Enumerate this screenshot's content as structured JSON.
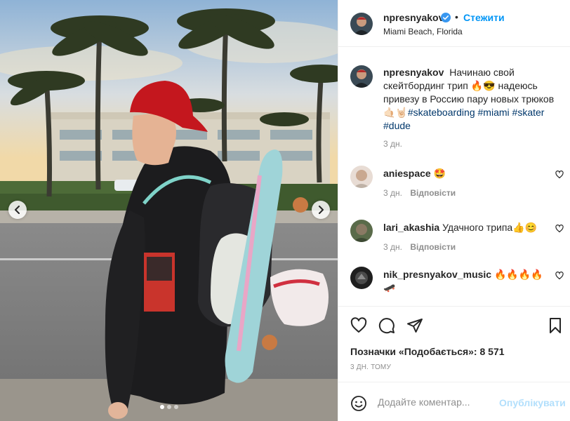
{
  "post_image": {
    "description_icon": "photo",
    "prev_icon": "chevron-left-icon",
    "next_icon": "chevron-right-icon",
    "carousel_count": 3,
    "carousel_active": 1
  },
  "header": {
    "username": "npresnyakov",
    "verified_icon": "verified-badge-icon",
    "separator": "•",
    "follow_label": "Стежити",
    "location": "Miami Beach, Florida"
  },
  "caption": {
    "username": "npresnyakov",
    "text_part1": "Начинаю свой скейтбординг трип 🔥😎 надеюсь привезу в Россию пару новых трюков 🤙🏻🤘🏻",
    "hashtags": [
      "#skateboarding",
      "#miami",
      "#skater",
      "#dude"
    ],
    "time": "3 дн."
  },
  "comments": [
    {
      "username": "aniespace",
      "text": "🤩",
      "time": "3 дн.",
      "reply_label": "Відповісти"
    },
    {
      "username": "lari_akashia",
      "text": "Удачного трипа👍😊",
      "time": "3 дн.",
      "reply_label": "Відповісти"
    },
    {
      "username": "nik_presnyakov_music",
      "text": "🔥🔥🔥🔥 🛹",
      "time": "",
      "reply_label": ""
    }
  ],
  "actions": {
    "like_icon": "heart-icon",
    "comment_icon": "comment-icon",
    "share_icon": "send-icon",
    "save_icon": "bookmark-icon",
    "likes_text": "Позначки «Подобається»: 8 571",
    "posted_ago": "3 ДН. ТОМУ"
  },
  "add_comment": {
    "emoji_icon": "smiley-icon",
    "placeholder": "Додайте коментар...",
    "publish_label": "Опублікувати"
  },
  "colors": {
    "link_blue": "#0095f6",
    "publish_disabled": "#b2dffc",
    "hashtag": "#00376b",
    "muted": "#8e8e8e",
    "border": "#efefef"
  }
}
